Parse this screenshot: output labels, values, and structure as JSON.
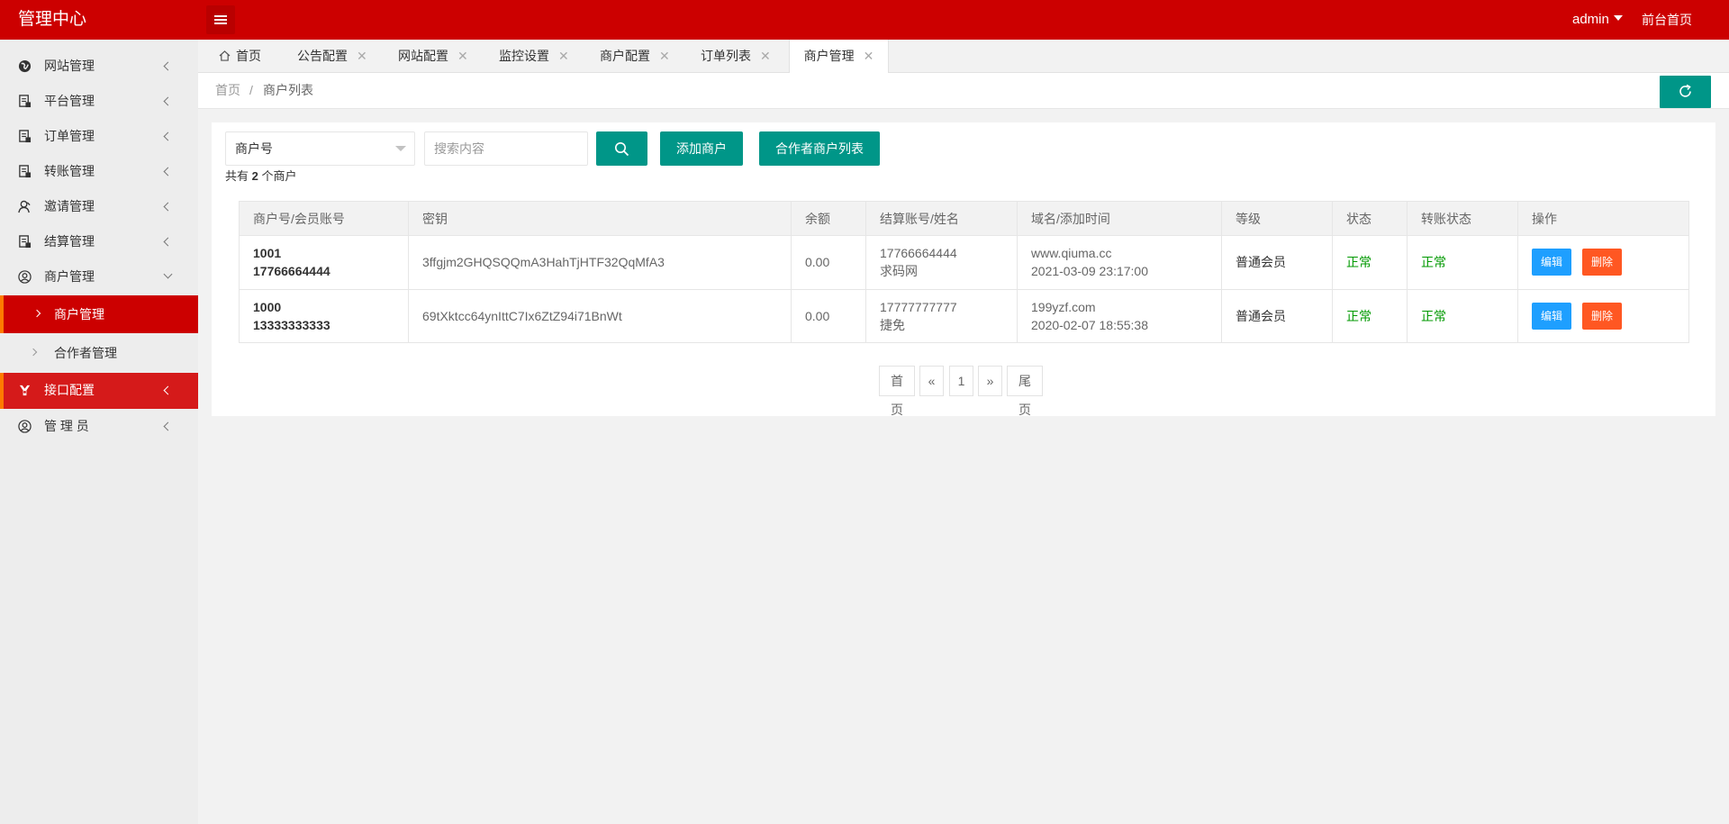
{
  "header": {
    "logo": "管理中心",
    "user": "admin",
    "front_link": "前台首页"
  },
  "sidebar": {
    "items": [
      {
        "label": "网站管理",
        "icon": "globe-icon"
      },
      {
        "label": "平台管理",
        "icon": "document-icon"
      },
      {
        "label": "订单管理",
        "icon": "document-icon"
      },
      {
        "label": "转账管理",
        "icon": "document-icon"
      },
      {
        "label": "邀请管理",
        "icon": "user-icon"
      },
      {
        "label": "结算管理",
        "icon": "document-icon"
      },
      {
        "label": "商户管理",
        "icon": "user-circle-icon"
      },
      {
        "label": "接口配置",
        "icon": "interface-icon"
      },
      {
        "label": "管 理 员",
        "icon": "user-circle-icon"
      }
    ],
    "sub_items": [
      {
        "label": "商户管理"
      },
      {
        "label": "合作者管理"
      }
    ]
  },
  "tabs": [
    {
      "label": "首页"
    },
    {
      "label": "公告配置"
    },
    {
      "label": "网站配置"
    },
    {
      "label": "监控设置"
    },
    {
      "label": "商户配置"
    },
    {
      "label": "订单列表"
    },
    {
      "label": "商户管理"
    }
  ],
  "breadcrumb": {
    "home": "首页",
    "separator": "/",
    "current": "商户列表"
  },
  "toolbar": {
    "select_value": "商户号",
    "search_placeholder": "搜索内容",
    "add_label": "添加商户",
    "partner_label": "合作者商户列表"
  },
  "summary": {
    "prefix": "共有",
    "count": "2",
    "suffix": "个商户"
  },
  "table": {
    "headers": [
      "商户号/会员账号",
      "密钥",
      "余额",
      "结算账号/姓名",
      "域名/添加时间",
      "等级",
      "状态",
      "转账状态",
      "操作"
    ],
    "rows": [
      {
        "id": "1001",
        "account": "17766664444",
        "key": "3ffgjm2GHQSQQmA3HahTjHTF32QqMfA3",
        "balance": "0.00",
        "settle_account": "17766664444",
        "settle_name": "求码网",
        "domain": "www.qiuma.cc",
        "added": "2021-03-09 23:17:00",
        "level": "普通会员",
        "status": "正常",
        "transfer_status": "正常",
        "edit": "编辑",
        "delete": "删除"
      },
      {
        "id": "1000",
        "account": "13333333333",
        "key": "69tXktcc64ynIttC7Ix6ZtZ94i71BnWt",
        "balance": "0.00",
        "settle_account": "17777777777",
        "settle_name": "捷免",
        "domain": "199yzf.com",
        "added": "2020-02-07 18:55:38",
        "level": "普通会员",
        "status": "正常",
        "transfer_status": "正常",
        "edit": "编辑",
        "delete": "删除"
      }
    ]
  },
  "pager": {
    "first": "首页",
    "prev": "«",
    "page": "1",
    "next": "»",
    "last": "尾页"
  },
  "colors": {
    "header": "#cc0000",
    "accent": "#009688",
    "edit": "#1e9fff",
    "delete": "#ff5722",
    "status_ok": "#009900"
  }
}
